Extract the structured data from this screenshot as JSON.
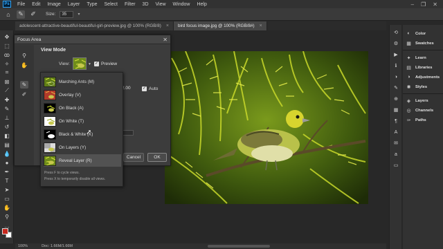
{
  "menubar": {
    "items": [
      "File",
      "Edit",
      "Image",
      "Layer",
      "Type",
      "Select",
      "Filter",
      "3D",
      "View",
      "Window",
      "Help"
    ]
  },
  "options": {
    "size_label": "Size:",
    "size_value": "35"
  },
  "tabs": [
    {
      "label": "adolescent-attractive-beautiful-beautiful-girl-preview.jpg @ 100% (RGB/8)"
    },
    {
      "label": "bird focus image.jpg @ 100% (RGB/8#)"
    }
  ],
  "panels": {
    "items": [
      {
        "label": "Color",
        "icon": "color-wheel-icon"
      },
      {
        "label": "Swatches",
        "icon": "swatches-grid-icon"
      },
      {
        "label": "Learn",
        "icon": "lightbulb-icon"
      },
      {
        "label": "Libraries",
        "icon": "libraries-icon"
      },
      {
        "label": "Adjustments",
        "icon": "adjustments-icon"
      },
      {
        "label": "Styles",
        "icon": "styles-icon"
      },
      {
        "label": "Layers",
        "icon": "layers-stack-icon"
      },
      {
        "label": "Channels",
        "icon": "channels-icon"
      },
      {
        "label": "Paths",
        "icon": "paths-icon"
      }
    ]
  },
  "dialog": {
    "title": "Focus Area",
    "view_mode_label": "View Mode",
    "view_label": "View:",
    "preview_label": "Preview",
    "parameter_value": "2.00",
    "auto_label": "Auto",
    "cancel_label": "Cancel",
    "ok_label": "OK"
  },
  "view_menu": {
    "items": [
      {
        "label": "Marching Ants (M)",
        "thumb": "marching"
      },
      {
        "label": "Overlay (V)",
        "thumb": "overlay"
      },
      {
        "label": "On Black (A)",
        "thumb": "black"
      },
      {
        "label": "On White (T)",
        "thumb": "white"
      },
      {
        "label": "Black & White (K)",
        "thumb": "bw"
      },
      {
        "label": "On Layers (Y)",
        "thumb": "layers"
      },
      {
        "label": "Reveal Layer (R)",
        "thumb": "reveal"
      }
    ],
    "selected_index": 6,
    "hints": [
      "Press F to cycle views.",
      "Press X to temporarily disable all views."
    ]
  },
  "status": {
    "zoom": "100%",
    "doc": "Doc: 1.66M/1.66M"
  },
  "colors": {
    "foreground": "#c8281e",
    "background": "#ffffff",
    "accent": "#31a8ff"
  }
}
